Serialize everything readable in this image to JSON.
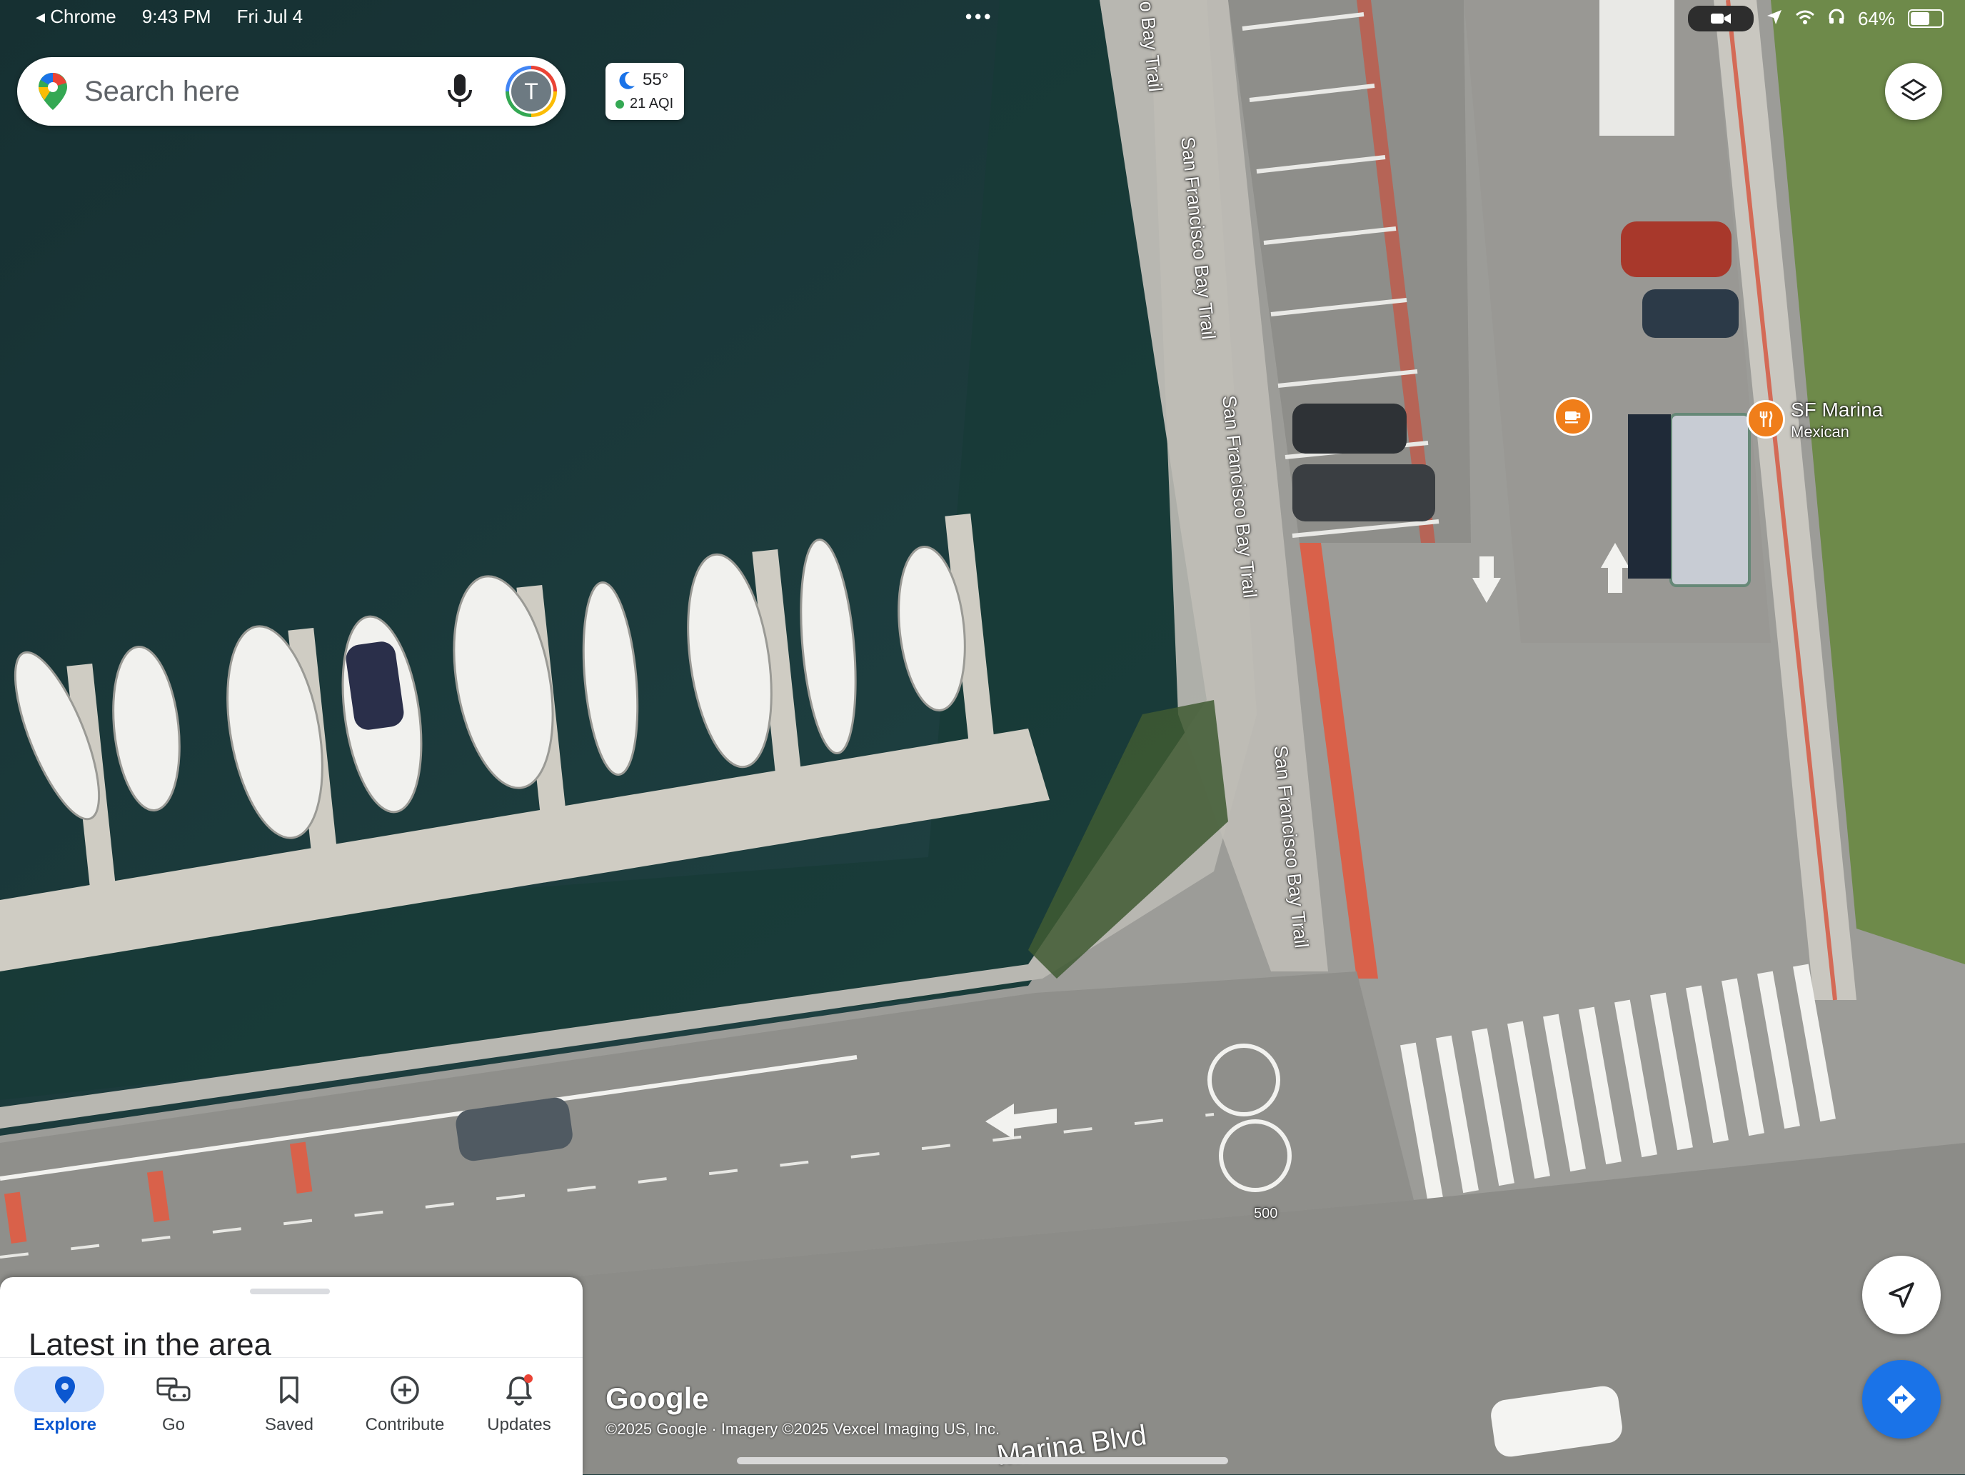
{
  "status_bar": {
    "back_app": "Chrome",
    "time": "9:43 PM",
    "date": "Fri Jul 4",
    "battery": "64%"
  },
  "search": {
    "placeholder": "Search here",
    "avatar_letter": "T"
  },
  "weather": {
    "temperature": "55°",
    "aqi": "21 AQI"
  },
  "map_labels": {
    "trail_top": "o Bay Trail",
    "trail_1": "San Francisco Bay Trail",
    "trail_2": "San Francisco Bay Trail",
    "trail_3": "San Francisco Bay Trail",
    "road_number": "500",
    "street": "Marina Blvd"
  },
  "pois": {
    "restaurant_name": "SF Marina",
    "restaurant_category": "Mexican",
    "cafe_icon": "coffee-icon",
    "restaurant_icon": "fork-knife-icon"
  },
  "sheet": {
    "title": "Latest in the area"
  },
  "nav": {
    "items": [
      {
        "label": "Explore",
        "icon": "location-pin-icon",
        "active": true
      },
      {
        "label": "Go",
        "icon": "commute-icon",
        "active": false
      },
      {
        "label": "Saved",
        "icon": "bookmark-icon",
        "active": false
      },
      {
        "label": "Contribute",
        "icon": "add-circle-icon",
        "active": false
      },
      {
        "label": "Updates",
        "icon": "bell-icon",
        "active": false
      }
    ]
  },
  "attribution": {
    "logo": "Google",
    "text": "©2025 Google · Imagery ©2025 Vexcel Imaging US, Inc."
  },
  "colors": {
    "water": "#1d3b3c",
    "pavement": "#a3a3a0",
    "accent_blue": "#1a73e8",
    "poi_orange": "#f07e1a"
  }
}
